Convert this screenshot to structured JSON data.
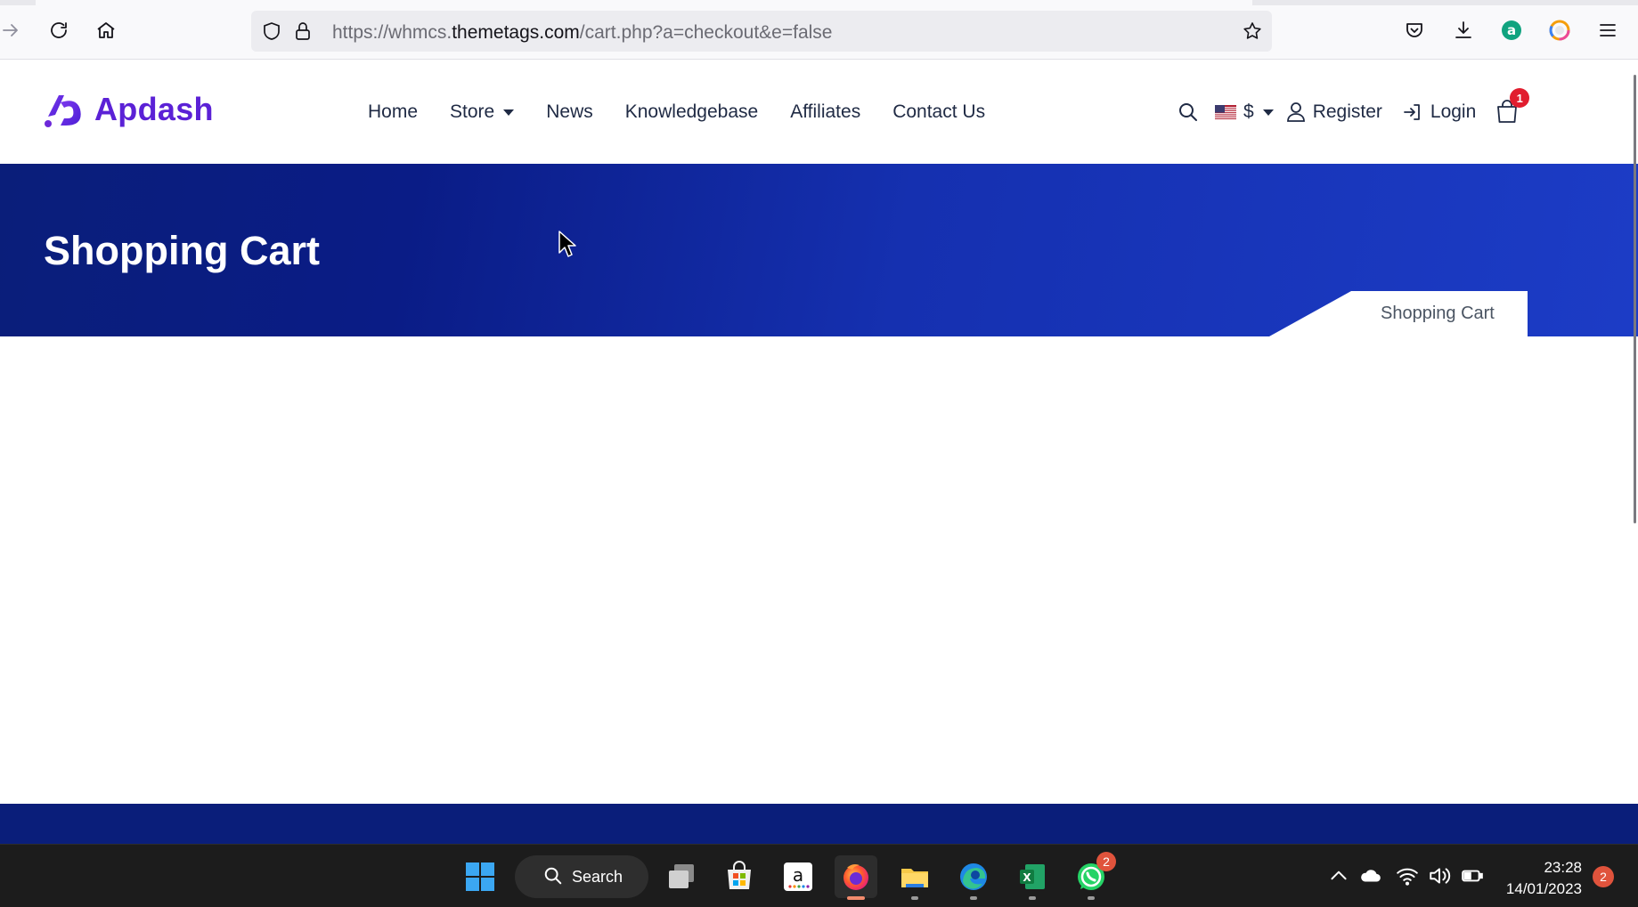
{
  "browser": {
    "url_prefix": "https://whmcs.",
    "url_host": "themetags.com",
    "url_path": "/cart.php?a=checkout&e=false"
  },
  "site": {
    "logo_text": "Apdash",
    "nav": [
      {
        "label": "Home"
      },
      {
        "label": "Store",
        "has_dropdown": true
      },
      {
        "label": "News"
      },
      {
        "label": "Knowledgebase"
      },
      {
        "label": "Affiliates"
      },
      {
        "label": "Contact Us"
      }
    ],
    "currency": "$",
    "register_label": "Register",
    "login_label": "Login",
    "cart_count": "1"
  },
  "hero": {
    "title": "Shopping Cart",
    "breadcrumb": "Shopping Cart"
  },
  "taskbar": {
    "search_label": "Search",
    "whatsapp_badge": "2",
    "time": "23:28",
    "date": "14/01/2023",
    "notification_count": "2"
  },
  "colors": {
    "brand": "#5b21d6",
    "hero_dark": "#0a1e7a",
    "hero_light": "#1c3cc6",
    "badge": "#e11d2e"
  }
}
